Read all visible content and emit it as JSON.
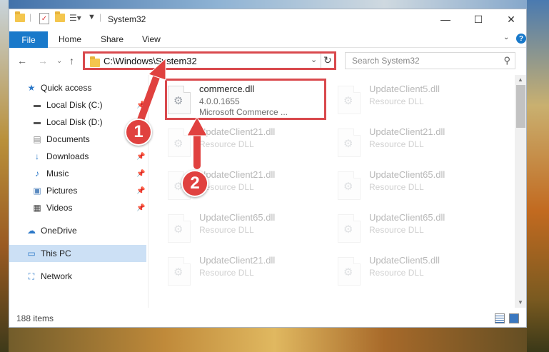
{
  "window": {
    "title": "System32",
    "controls": {
      "minimize": "—",
      "maximize": "☐",
      "close": "✕"
    }
  },
  "ribbon": {
    "tabs": [
      "File",
      "Home",
      "Share",
      "View"
    ],
    "help": "?"
  },
  "nav": {
    "address": "C:\\Windows\\System32",
    "search_placeholder": "Search System32"
  },
  "sidebar": {
    "items": [
      {
        "label": "Quick access",
        "icon": "star-icon",
        "pinned": false
      },
      {
        "label": "Local Disk (C:)",
        "icon": "drive-icon",
        "pinned": true
      },
      {
        "label": "Local Disk (D:)",
        "icon": "drive-icon",
        "pinned": false
      },
      {
        "label": "Documents",
        "icon": "documents-icon",
        "pinned": true
      },
      {
        "label": "Downloads",
        "icon": "download-icon",
        "pinned": true
      },
      {
        "label": "Music",
        "icon": "music-icon",
        "pinned": true
      },
      {
        "label": "Pictures",
        "icon": "pictures-icon",
        "pinned": true
      },
      {
        "label": "Videos",
        "icon": "videos-icon",
        "pinned": true
      },
      {
        "label": "OneDrive",
        "icon": "cloud-icon",
        "pinned": false
      },
      {
        "label": "This PC",
        "icon": "pc-icon",
        "pinned": false,
        "selected": true
      },
      {
        "label": "Network",
        "icon": "network-icon",
        "pinned": false
      }
    ]
  },
  "content": {
    "highlighted_file": {
      "name": "commerce.dll",
      "version": "4.0.0.1655",
      "description": "Microsoft Commerce ..."
    },
    "files": [
      {
        "name": "UpdateClient5.dll",
        "type": "Resource DLL"
      },
      {
        "name": "UpdateClient21.dll",
        "type": "Resource DLL"
      },
      {
        "name": "UpdateClient21.dll",
        "type": "Resource DLL"
      },
      {
        "name": "UpdateClient21.dll",
        "type": "Resource DLL"
      },
      {
        "name": "UpdateClient65.dll",
        "type": "Resource DLL"
      },
      {
        "name": "UpdateClient65.dll",
        "type": "Resource DLL"
      },
      {
        "name": "UpdateClient65.dll",
        "type": "Resource DLL"
      },
      {
        "name": "UpdateClient21.dll",
        "type": "Resource DLL"
      },
      {
        "name": "UpdateClient5.dll",
        "type": "Resource DLL"
      }
    ]
  },
  "status": {
    "item_count": "188 items"
  },
  "annotations": {
    "step1": "1",
    "step2": "2",
    "color": "#e0413f"
  }
}
